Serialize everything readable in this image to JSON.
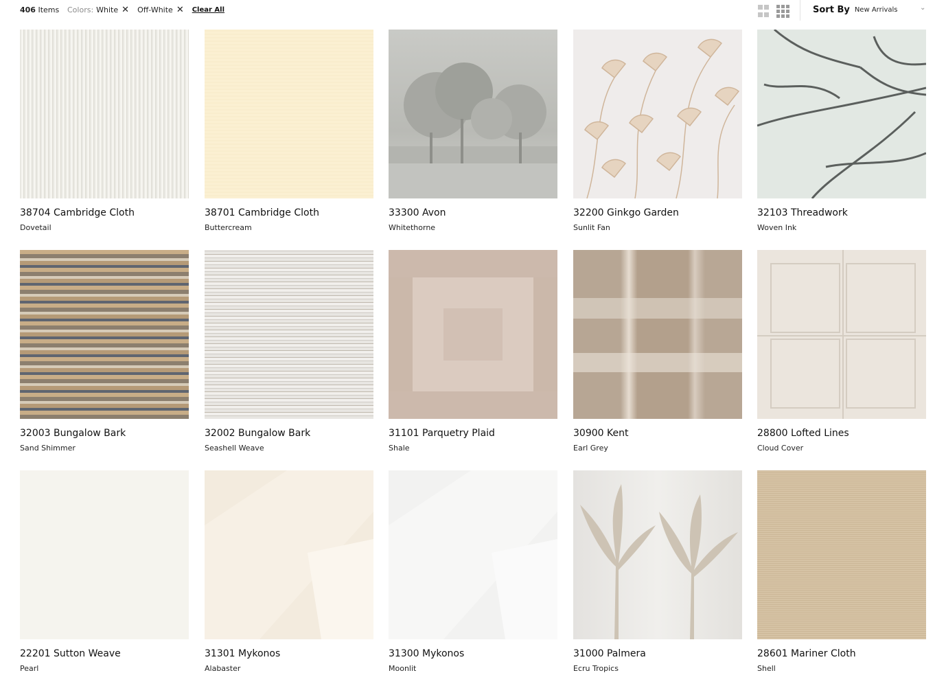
{
  "toolbar": {
    "count": "406",
    "count_label": "Items",
    "colors_label": "Colors:",
    "filters": [
      "White",
      "Off-White"
    ],
    "clear_all": "Clear All",
    "sort_label": "Sort By",
    "sort_value": "New Arrivals"
  },
  "products": [
    {
      "title": "38704 Cambridge Cloth",
      "color": "Dovetail"
    },
    {
      "title": "38701 Cambridge Cloth",
      "color": "Buttercream"
    },
    {
      "title": "33300 Avon",
      "color": "Whitethorne"
    },
    {
      "title": "32200 Ginkgo Garden",
      "color": "Sunlit Fan"
    },
    {
      "title": "32103 Threadwork",
      "color": "Woven Ink"
    },
    {
      "title": "32003 Bungalow Bark",
      "color": "Sand Shimmer"
    },
    {
      "title": "32002 Bungalow Bark",
      "color": "Seashell Weave"
    },
    {
      "title": "31101 Parquetry Plaid",
      "color": "Shale"
    },
    {
      "title": "30900 Kent",
      "color": "Earl Grey"
    },
    {
      "title": "28800 Lofted Lines",
      "color": "Cloud Cover"
    },
    {
      "title": "22201 Sutton Weave",
      "color": "Pearl"
    },
    {
      "title": "31301 Mykonos",
      "color": "Alabaster"
    },
    {
      "title": "31300 Mykonos",
      "color": "Moonlit"
    },
    {
      "title": "31000 Palmera",
      "color": "Ecru Tropics"
    },
    {
      "title": "28601 Mariner Cloth",
      "color": "Shell"
    }
  ]
}
